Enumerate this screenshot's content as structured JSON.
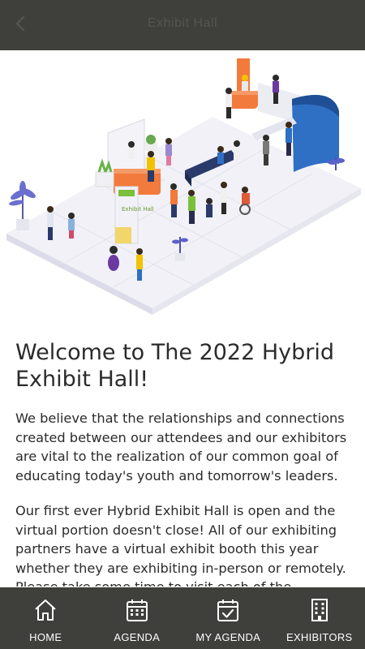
{
  "header": {
    "title": "Exhibit Hall",
    "back_icon": "chevron-left-icon"
  },
  "hero": {
    "sign_text": "Exhibit Hall"
  },
  "main": {
    "heading": "Welcome to The 2022 Hybrid Exhibit Hall!",
    "paragraphs": [
      "We believe that the relationships and connections created between our attendees and our exhibitors are vital to the realization of our common goal of educating today's youth and tomorrow's leaders.",
      "Our first ever Hybrid Exhibit Hall is open and the virtual portion doesn't close! All of our exhibiting partners have a virtual exhibit booth this year whether they are exhibiting in-person or remotely. Please take some time to visit each of the"
    ]
  },
  "tabs": [
    {
      "label": "HOME",
      "icon": "home-icon"
    },
    {
      "label": "AGENDA",
      "icon": "calendar-icon"
    },
    {
      "label": "MY AGENDA",
      "icon": "calendar-check-icon"
    },
    {
      "label": "EXHIBITORS",
      "icon": "building-icon"
    }
  ],
  "colors": {
    "bar_bg": "#3f3f3c",
    "booth_orange": "#f27a3c",
    "booth_blue": "#2f6fc4",
    "accent_green": "#7bbf3a"
  }
}
